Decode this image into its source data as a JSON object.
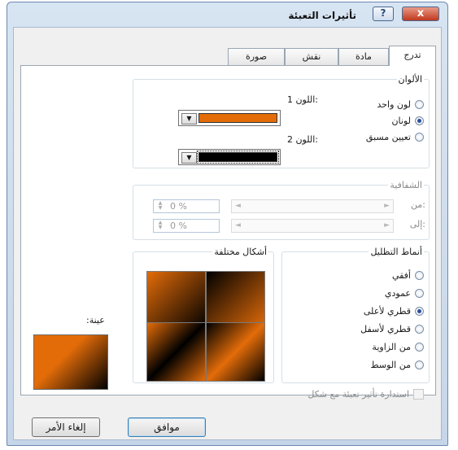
{
  "window": {
    "title": "تأثيرات التعبئة",
    "help_label": "?",
    "close_label": "x"
  },
  "tabs": [
    {
      "label": "تدرج",
      "active": true
    },
    {
      "label": "مادة",
      "active": false
    },
    {
      "label": "نقش",
      "active": false
    },
    {
      "label": "صورة",
      "active": false
    }
  ],
  "colors_group": {
    "legend": "الألوان",
    "options": [
      {
        "label": "لون واحد",
        "selected": false
      },
      {
        "label": "لونان",
        "selected": true
      },
      {
        "label": "تعيين مسبق",
        "selected": false
      }
    ],
    "color1_label": "اللون 1:",
    "color2_label": "اللون 2:",
    "color1_value": "#e36c09",
    "color2_value": "#000000"
  },
  "transparency_group": {
    "legend": "الشفافية",
    "from_label": "من:",
    "to_label": "إلى:",
    "from_value": "0 %",
    "to_value": "0 %"
  },
  "shading_group": {
    "legend": "أنماط التظليل",
    "options": [
      {
        "label": "أفقي",
        "selected": false
      },
      {
        "label": "عمودي",
        "selected": false
      },
      {
        "label": "قطري لأعلى",
        "selected": true
      },
      {
        "label": "قطري لأسفل",
        "selected": false
      },
      {
        "label": "من الزاوية",
        "selected": false
      },
      {
        "label": "من الوسط",
        "selected": false
      }
    ]
  },
  "variants_group": {
    "legend": "أشكال مختلفة"
  },
  "sample": {
    "label": "عينة:"
  },
  "rotate_checkbox": {
    "label": "استدارة تأثير تعبئة مع شكل",
    "checked": false
  },
  "buttons": {
    "ok": "موافق",
    "cancel": "إلغاء الأمر"
  },
  "accent": {
    "orange": "#e36c09",
    "black": "#000000"
  }
}
